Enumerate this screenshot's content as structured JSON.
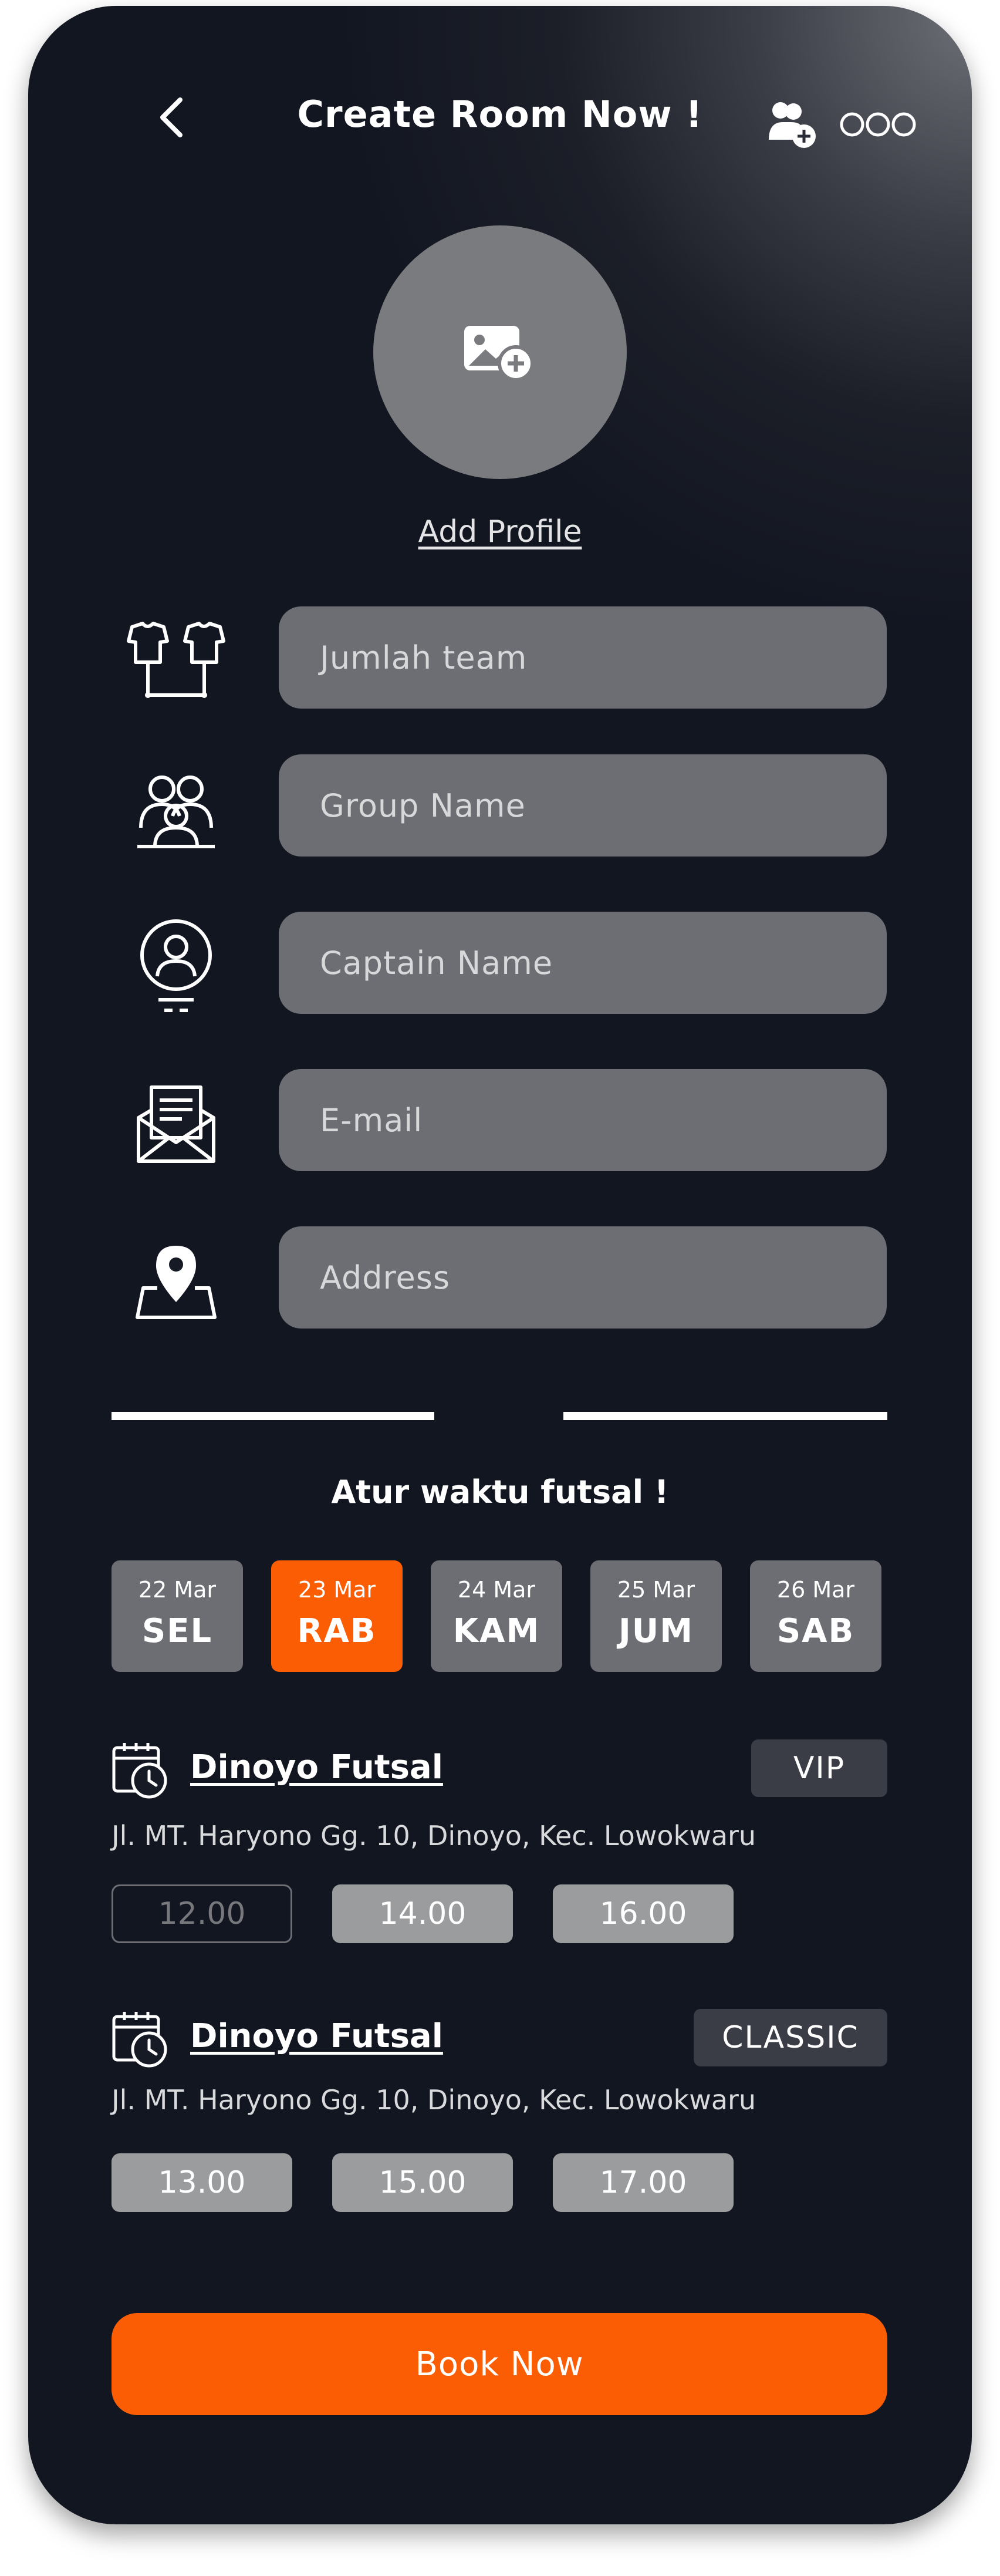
{
  "header": {
    "title": "Create Room Now !"
  },
  "profile": {
    "add_label": "Add Profile"
  },
  "form": {
    "fields": [
      {
        "placeholder": "Jumlah team",
        "icon": "jersey-icon"
      },
      {
        "placeholder": "Group Name",
        "icon": "group-icon"
      },
      {
        "placeholder": "Captain Name",
        "icon": "captain-icon"
      },
      {
        "placeholder": "E-mail",
        "icon": "mail-icon"
      },
      {
        "placeholder": "Address",
        "icon": "location-icon"
      }
    ]
  },
  "schedule": {
    "title": "Atur waktu futsal !",
    "days": [
      {
        "date": "22 Mar",
        "day": "SEL",
        "selected": false
      },
      {
        "date": "23 Mar",
        "day": "RAB",
        "selected": true
      },
      {
        "date": "24 Mar",
        "day": "KAM",
        "selected": false
      },
      {
        "date": "25 Mar",
        "day": "JUM",
        "selected": false
      },
      {
        "date": "26 Mar",
        "day": "SAB",
        "selected": false
      }
    ]
  },
  "venues": [
    {
      "name": "Dinoyo Futsal",
      "badge": "VIP",
      "address": "Jl. MT. Haryono  Gg. 10, Dinoyo, Kec. Lowokwaru",
      "slots": [
        "12.00",
        "14.00",
        "16.00"
      ],
      "unavailable_slot": "12.00"
    },
    {
      "name": "Dinoyo Futsal",
      "badge": "CLASSIC",
      "address": "Jl. MT. Haryono  Gg. 10, Dinoyo, Kec. Lowokwaru",
      "slots": [
        "13.00",
        "15.00",
        "17.00"
      ]
    }
  ],
  "actions": {
    "book_label": "Book Now"
  },
  "colors": {
    "accent": "#fb5d04",
    "background": "#121621",
    "field": "#6c6e73",
    "slot": "#9b9c9e"
  }
}
